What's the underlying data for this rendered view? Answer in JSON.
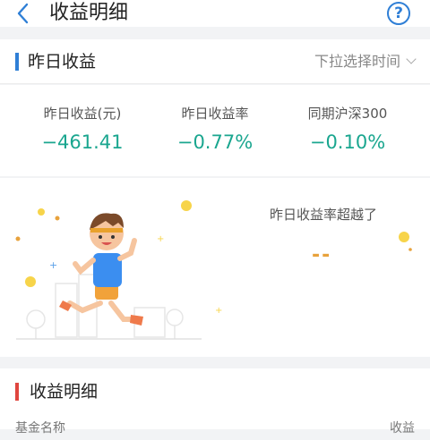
{
  "header": {
    "title": "收益明细",
    "back_icon": "chevron-left-icon",
    "help_icon": "question-circle-icon",
    "help_glyph": "?"
  },
  "yesterday": {
    "section_title": "昨日收益",
    "time_selector": "下拉选择时间",
    "stats": [
      {
        "label": "昨日收益(元)",
        "value": "−461.41"
      },
      {
        "label": "昨日收益率",
        "value": "−0.77%"
      },
      {
        "label": "同期沪深300",
        "value": "−0.10%"
      }
    ],
    "exceed_label": "昨日收益率超越了",
    "exceed_value": "--"
  },
  "details": {
    "section_title": "收益明细",
    "col_fund_name": "基金名称",
    "col_income": "收益"
  },
  "colors": {
    "accent_blue": "#2f7fd6",
    "value_green": "#1aa68f",
    "accent_red": "#e0463f",
    "orange": "#e8a23c"
  }
}
